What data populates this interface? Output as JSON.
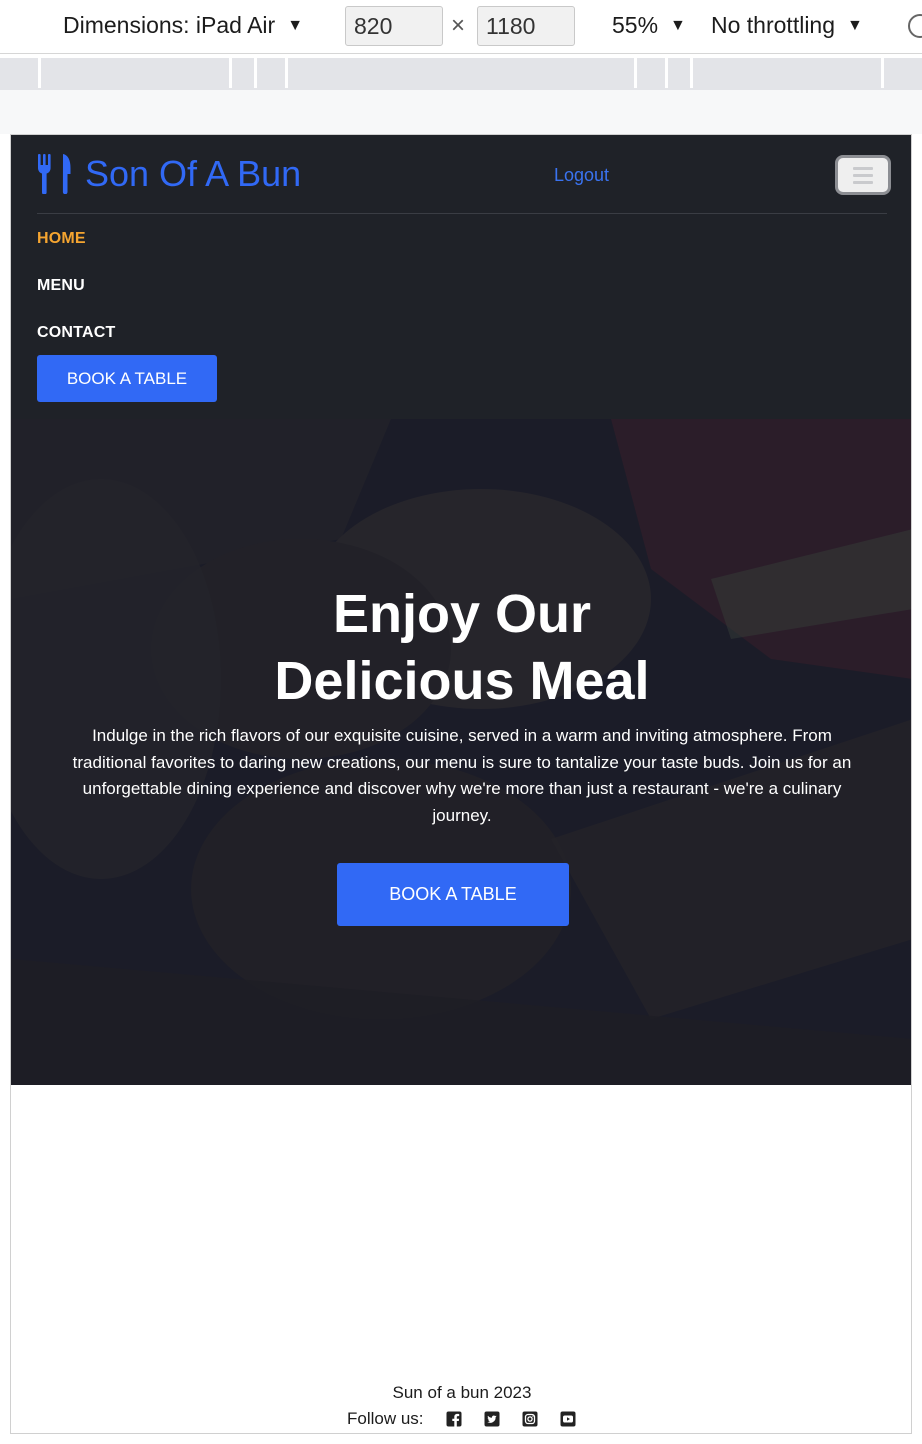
{
  "devtools": {
    "device_label": "Dimensions: iPad Air",
    "width_value": "820",
    "height_value": "1180",
    "times_symbol": "×",
    "zoom": "55%",
    "throttling": "No throttling",
    "caret": "▼"
  },
  "site": {
    "brand": {
      "name": "Son Of A Bun",
      "icon": "utensils-icon",
      "color": "#3169f5"
    },
    "navbar": {
      "logout_label": "Logout",
      "toggle_icon": "hamburger-icon",
      "items": [
        {
          "label": "HOME",
          "active": true
        },
        {
          "label": "MENU",
          "active": false
        },
        {
          "label": "CONTACT",
          "active": false
        }
      ],
      "book_label": "BOOK A TABLE",
      "active_color": "#f5a530",
      "background": "#1f2228"
    },
    "hero": {
      "title_line1": "Enjoy Our",
      "title_line2": "Delicious Meal",
      "text": "Indulge in the rich flavors of our exquisite cuisine, served in a warm and inviting atmosphere. From traditional favorites to daring new creations, our menu is sure to tantalize your taste buds. Join us for an unforgettable dining experience and discover why we're more than just a restaurant - we're a culinary journey.",
      "book_label": "BOOK A TABLE"
    },
    "footer": {
      "copyright": "Sun of a bun 2023",
      "follow_label": "Follow us:",
      "social_icons": [
        "facebook-icon",
        "twitter-icon",
        "instagram-icon",
        "youtube-icon"
      ]
    }
  }
}
